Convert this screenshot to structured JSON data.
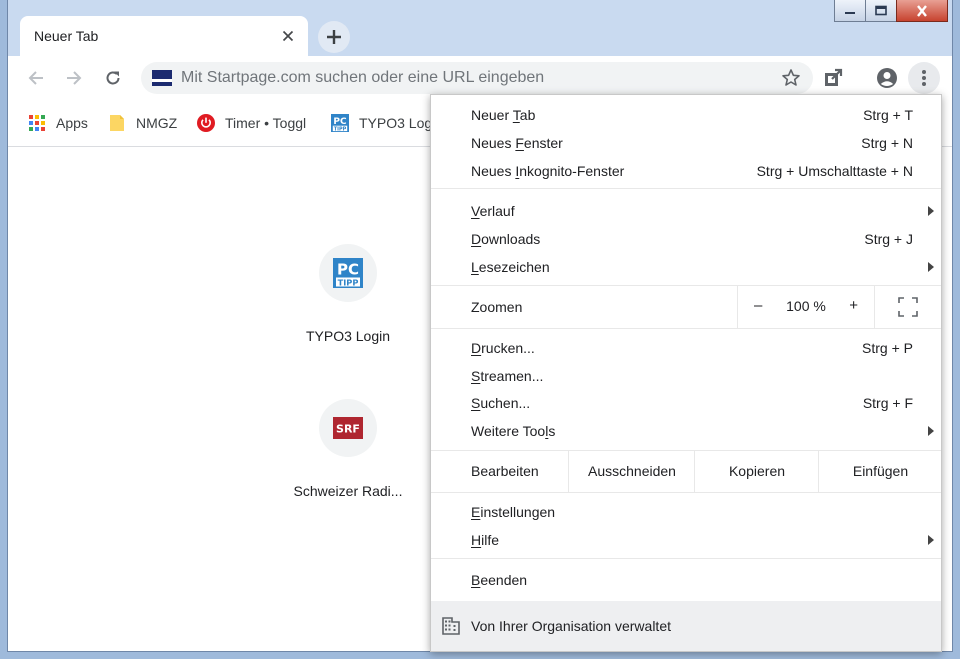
{
  "window": {
    "tab_title": "Neuer Tab"
  },
  "omnibox": {
    "placeholder": "Mit Startpage.com suchen oder eine URL eingeben"
  },
  "bookmarks": [
    {
      "label": "Apps",
      "icon": "apps-grid-icon"
    },
    {
      "label": "NMGZ",
      "icon": "folder-icon"
    },
    {
      "label": "Timer • Toggl",
      "icon": "toggl-power-icon"
    },
    {
      "label": "TYPO3 Log",
      "icon": "pctipp-icon"
    }
  ],
  "tiles": [
    {
      "label": "TYPO3 Login",
      "icon_text": "PC",
      "icon_sub": "TIPP"
    },
    {
      "label": "Schweizer Radi...",
      "icon_text": "SRF"
    }
  ],
  "menu": {
    "new_tab": {
      "pre": "Neuer ",
      "u": "T",
      "post": "ab",
      "shortcut": "Strg + T"
    },
    "new_window": {
      "pre": "Neues ",
      "u": "F",
      "post": "enster",
      "shortcut": "Strg + N"
    },
    "incognito": {
      "pre": "Neues ",
      "u": "I",
      "post": "nkognito-Fenster",
      "shortcut": "Strg + Umschalttaste + N"
    },
    "history": {
      "pre": "",
      "u": "V",
      "post": "erlauf"
    },
    "downloads": {
      "pre": "",
      "u": "D",
      "post": "ownloads",
      "shortcut": "Strg + J"
    },
    "bookmarks": {
      "pre": "",
      "u": "L",
      "post": "esezeichen"
    },
    "zoom": {
      "label": "Zoomen",
      "minus": "–",
      "value": "100 %",
      "plus": "+"
    },
    "print": {
      "pre": "",
      "u": "D",
      "post": "rucken...",
      "shortcut": "Strg + P"
    },
    "cast": {
      "pre": "",
      "u": "S",
      "post": "treamen..."
    },
    "find": {
      "pre": "",
      "u": "S",
      "post": "uchen...",
      "shortcut": "Strg + F"
    },
    "more_tools": {
      "pre": "Weitere Too",
      "u": "l",
      "post": "s"
    },
    "edit": {
      "label": "Bearbeiten",
      "cut": "Ausschneiden",
      "copy": "Kopieren",
      "paste": "Einfügen"
    },
    "settings": {
      "pre": "",
      "u": "E",
      "post": "instellungen"
    },
    "help": {
      "pre": "",
      "u": "H",
      "post": "ilfe"
    },
    "exit": {
      "pre": "",
      "u": "B",
      "post": "eenden"
    },
    "managed": "Von Ihrer Organisation verwaltet"
  },
  "colors": {
    "accent": "#1a73e8",
    "toggl_red": "#e01b22",
    "srf_red": "#af2630",
    "pctipp_blue": "#2f84c8"
  }
}
